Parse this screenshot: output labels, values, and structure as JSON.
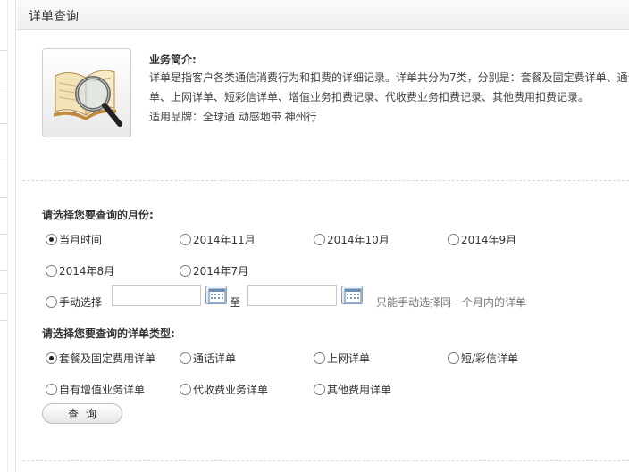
{
  "header": {
    "title": "详单查询"
  },
  "intro": {
    "image": "detail-bill-magnifier-icon",
    "title": "业务简介:",
    "lines": [
      "详单是指客户各类通信消费行为和扣费的详细记录。详单共分为7类，分别是：套餐及固定费详单、通话详",
      "单、上网详单、短彩信详单、增值业务扣费记录、代收费业务扣费记录、其他费用扣费记录。",
      "适用品牌：全球通 动感地带 神州行"
    ]
  },
  "month_section": {
    "label": "请选择您要查询的月份:",
    "options": [
      {
        "label": "当月时间",
        "checked": true
      },
      {
        "label": "2014年11月",
        "checked": false
      },
      {
        "label": "2014年10月",
        "checked": false
      },
      {
        "label": "2014年9月",
        "checked": false
      },
      {
        "label": "2014年8月",
        "checked": false
      },
      {
        "label": "2014年7月",
        "checked": false
      }
    ],
    "manual": {
      "label": "手动选择",
      "checked": false,
      "start_value": "",
      "end_value": "",
      "to_text": "至",
      "hint": "只能手动选择同一个月内的详单",
      "calendar_icon": "calendar-icon"
    }
  },
  "type_section": {
    "label": "请选择您要查询的详单类型:",
    "options": [
      {
        "label": "套餐及固定费用详单",
        "checked": true
      },
      {
        "label": "通话详单",
        "checked": false
      },
      {
        "label": "上网详单",
        "checked": false
      },
      {
        "label": "短/彩信详单",
        "checked": false
      },
      {
        "label": "自有增值业务详单",
        "checked": false
      },
      {
        "label": "代收费业务详单",
        "checked": false
      },
      {
        "label": "其他费用详单",
        "checked": false
      }
    ]
  },
  "query_button": {
    "label": "查询"
  }
}
